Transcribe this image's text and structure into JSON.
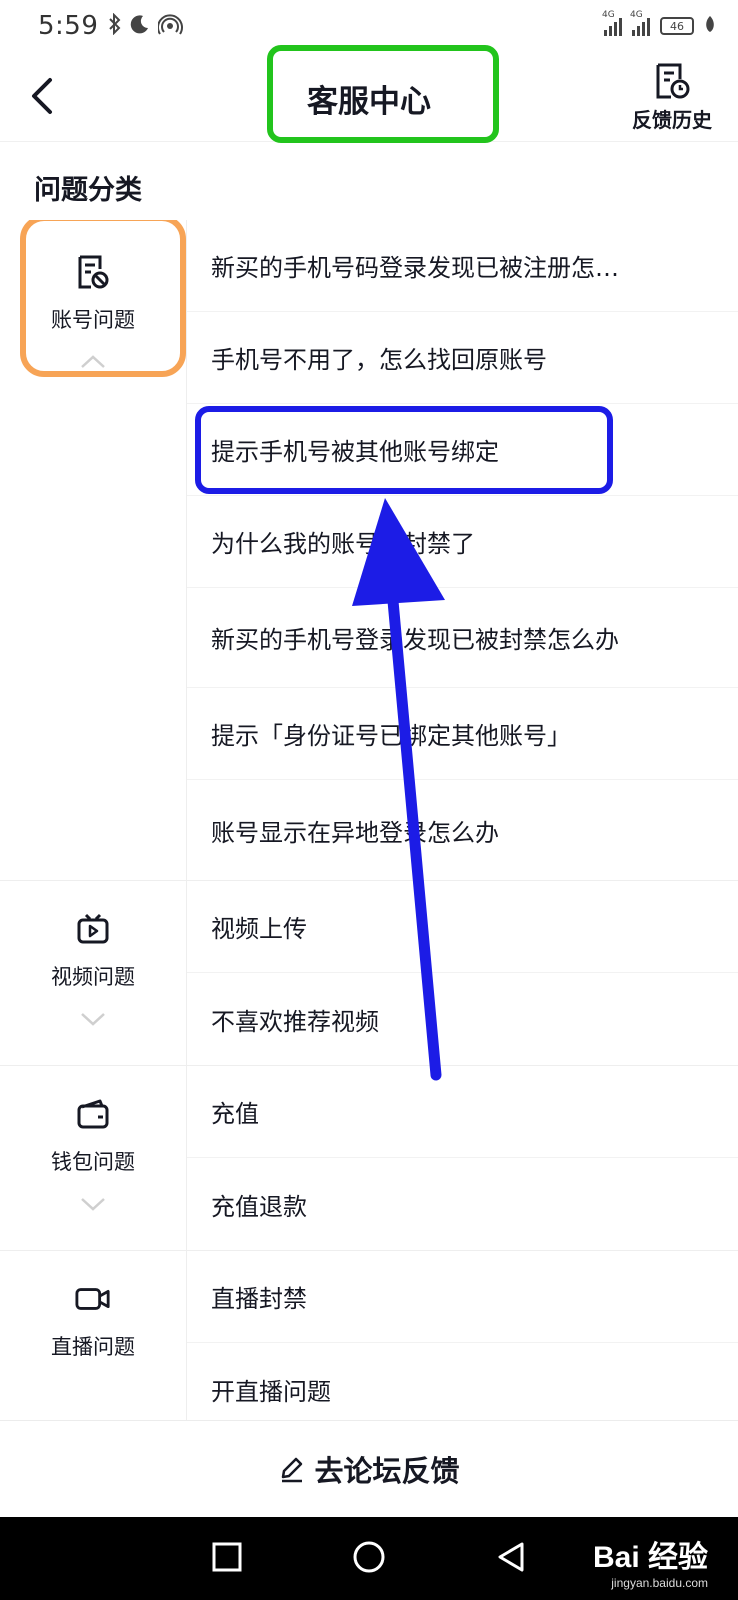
{
  "status_bar": {
    "time": "5:59",
    "signal_1": "4G",
    "signal_2": "4G",
    "battery": "46"
  },
  "header": {
    "title": "客服中心",
    "history_label": "反馈历史"
  },
  "section_title": "问题分类",
  "categories": [
    {
      "label": "账号问题",
      "icon": "account-doc-icon",
      "questions": [
        "新买的手机号码登录发现已被注册怎…",
        "手机号不用了，怎么找回原账号",
        "提示手机号被其他账号绑定",
        "为什么我的账号被封禁了",
        "新买的手机号登录发现已被封禁怎么办",
        "提示「身份证号已绑定其他账号」",
        "账号显示在异地登录怎么办"
      ]
    },
    {
      "label": "视频问题",
      "icon": "tv-icon",
      "questions": [
        "视频上传",
        "不喜欢推荐视频"
      ]
    },
    {
      "label": "钱包问题",
      "icon": "wallet-icon",
      "questions": [
        "充值",
        "充值退款"
      ]
    },
    {
      "label": "直播问题",
      "icon": "camera-icon",
      "questions": [
        "直播封禁",
        "开直播问题"
      ]
    }
  ],
  "footer": {
    "label": "去论坛反馈"
  },
  "watermark": {
    "logo": "Bai 经验",
    "url": "jingyan.baidu.com"
  },
  "colors": {
    "title_box": "#22c41c",
    "category_box": "#f7a456",
    "question_box": "#1c1ce6",
    "arrow": "#1c1ce6"
  }
}
